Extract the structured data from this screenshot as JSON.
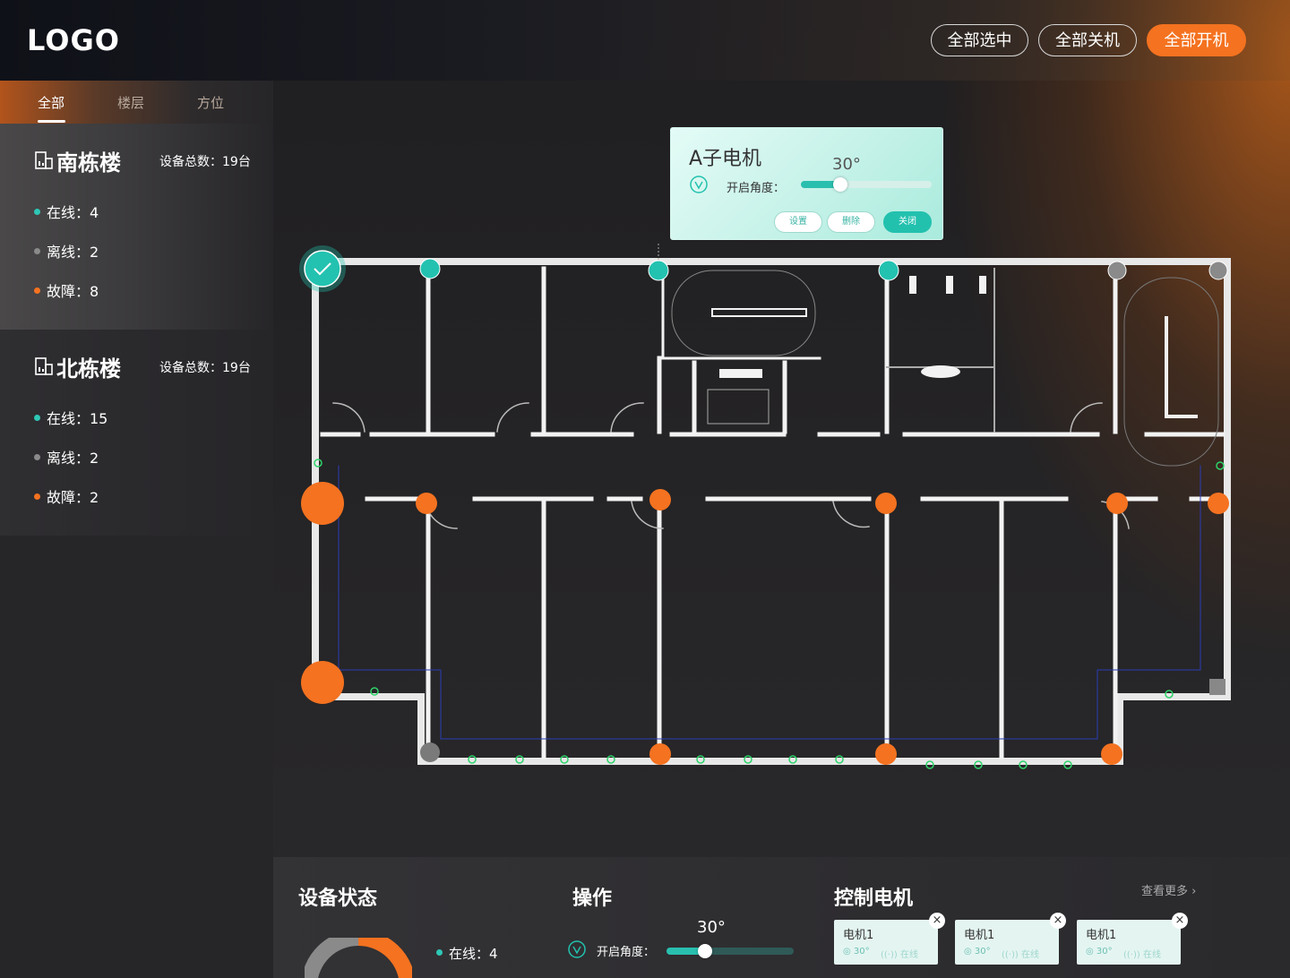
{
  "header": {
    "logo": "LOGO",
    "buttons": {
      "select_all": "全部选中",
      "all_off": "全部关机",
      "all_on": "全部开机"
    }
  },
  "sidebar": {
    "tabs": [
      "全部",
      "楼层",
      "方位"
    ],
    "buildings": [
      {
        "name": "南栋楼",
        "total": "设备总数：19台",
        "online": "在线：4",
        "offline": "离线：2",
        "fault": "故障：8"
      },
      {
        "name": "北栋楼",
        "total": "设备总数：19台",
        "online": "在线：15",
        "offline": "离线：2",
        "fault": "故障：2"
      }
    ]
  },
  "popup": {
    "title": "A子电机",
    "value": "30°",
    "label": "开启角度：",
    "level_percent": 30,
    "buttons": {
      "set": "设置",
      "delete": "删除",
      "close": "关闭"
    }
  },
  "bottom": {
    "status_title": "设备状态",
    "status_online": "在线：4",
    "op_title": "操作",
    "op_value": "30°",
    "op_label": "开启角度：",
    "op_level_percent": 30,
    "control_title": "控制电机",
    "more": "查看更多 ›",
    "cards": [
      {
        "name": "电机1",
        "angle": "30°",
        "status": "在线"
      },
      {
        "name": "电机1",
        "angle": "30°",
        "status": "在线"
      },
      {
        "name": "电机1",
        "angle": "30°",
        "status": "在线"
      }
    ]
  },
  "colors": {
    "accent": "#f47220",
    "teal": "#22c1ae",
    "gray": "#8a8a8a"
  }
}
